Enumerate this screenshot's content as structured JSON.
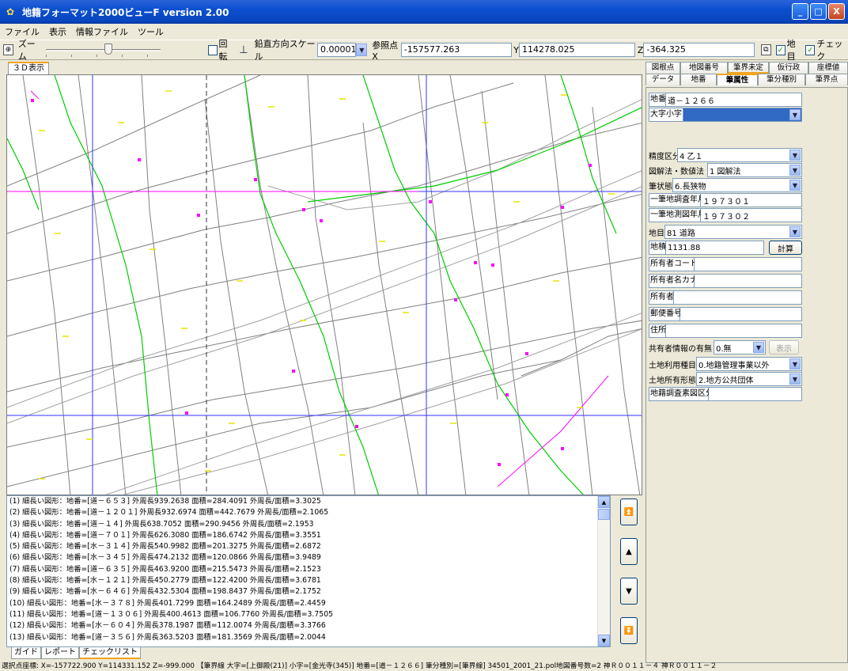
{
  "window": {
    "title": "地籍フォーマット2000ビューF version 2.00",
    "minimize": "_",
    "maximize": "□",
    "close": "X"
  },
  "menu": [
    "ファイル",
    "表示",
    "情報ファイル",
    "ツール"
  ],
  "toolbar": {
    "zoom_label": "ズーム",
    "zoom_level": 0.55,
    "rotate_label": "回転",
    "vscale_label": "鉛直方向スケール",
    "vscale_value": "0.00001",
    "refpt_label": "参照点X",
    "x_value": "-157577.263",
    "y_label": "Y",
    "y_value": "114278.025",
    "z_label": "Z",
    "z_value": "-364.325",
    "chimoku_label": "地目",
    "check_label": "チェック"
  },
  "map": {
    "tab_label": "３Ｄ表示"
  },
  "right": {
    "tabs_row1": [
      "図根点",
      "地図番号",
      "筆界未定",
      "仮行政",
      "座標値"
    ],
    "tabs_row2": [
      "データ",
      "地番",
      "筆属性",
      "筆分種別",
      "筆界点"
    ],
    "fields": {
      "chiban_label": "地番",
      "chiban_value": "道－１２６６",
      "oaza_label": "大字小字",
      "seido_label": "精度区分",
      "seido_value": "4 乙１",
      "zukai_label": "図解法・数値法",
      "zukai_value": "1 図解法",
      "hitsujo_label": "筆状態",
      "hitsujo_value": "6.長狭物",
      "chosa_label": "一筆地調査年月",
      "chosa_value": "１９７３０１",
      "sokuryo_label": "一筆地測図年月",
      "sokuryo_value": "１９７３０２",
      "chimoku_label": "地目",
      "chimoku_value": "81 道路",
      "chiseki_label": "地積",
      "chiseki_value": "1131.88",
      "calc_button": "計算",
      "owner_code_label": "所有者コード",
      "owner_kana_label": "所有者名カナ",
      "owner_label": "所有者",
      "postal_label": "郵便番号",
      "address_label": "住所",
      "kyoyu_label": "共有者情報の有無",
      "kyoyu_value": "0.無",
      "display_button": "表示",
      "riyo_label": "土地利用種目",
      "riyo_value": "0.地籍管理事業以外",
      "shoyu_label": "土地所有形態",
      "shoyu_value": "2.地方公共団体",
      "sozu_label": "地籍調査素図区分"
    }
  },
  "output_lines": [
    "(1) 細長い図形：地番=[道－６５３] 外周長939.2638 面積=284.4091 外周長/面積=3.3025",
    "(2) 細長い図形：地番=[道－１２０１] 外周長932.6974 面積=442.7679 外周長/面積=2.1065",
    "(3) 細長い図形：地番=[道－１４] 外周長638.7052 面積=290.9456 外周長/面積=2.1953",
    "(4) 細長い図形：地番=[道－７０１] 外周長626.3080 面積=186.6742 外周長/面積=3.3551",
    "(5) 細長い図形：地番=[水－３１４] 外周長540.9982 面積=201.3275 外周長/面積=2.6872",
    "(6) 細長い図形：地番=[水－３４５] 外周長474.2132 面積=120.0866 外周長/面積=3.9489",
    "(7) 細長い図形：地番=[道－６３５] 外周長463.9200 面積=215.5473 外周長/面積=2.1523",
    "(8) 細長い図形：地番=[水－１２１] 外周長450.2779 面積=122.4200 外周長/面積=3.6781",
    "(9) 細長い図形：地番=[水－６４６] 外周長432.5304 面積=198.8437 外周長/面積=2.1752",
    "(10) 細長い図形：地番=[水－３７８] 外周長401.7299 面積=164.2489 外周長/面積=2.4459",
    "(11) 細長い図形：地番=[道－１３０６] 外周長400.4613 面積=106.7760 外周長/面積=3.7505",
    "(12) 細長い図形：地番=[水－６０４] 外周長378.1987 面積=112.0074 外周長/面積=3.3766",
    "(13) 細長い図形：地番=[道－３５６] 外周長363.5203 面積=181.3569 外周長/面積=2.0044"
  ],
  "nav": {
    "first": "⏫",
    "up": "▲",
    "down": "▼",
    "last": "⏬"
  },
  "bottom_tabs": [
    "ガイド",
    "レポート",
    "チェックリスト"
  ],
  "status": "選択点座標: X=-157722.900 Y=114331.152 Z=-999.000 【筆界線 大字=[上御殿(21)] 小字=[金光寺(345)] 地番=[道－１２６６] 筆分種別=[筆界線] 34501_2001_21.pol地図番号数=2 神Ｒ００１１－４ 神Ｒ００１１－２",
  "colors": {
    "title_bar": "#0b4fcf",
    "parcel_line": "#808080",
    "road_line": "#00cc00",
    "grid_line": "#3333ff",
    "magenta": "#ff00ff",
    "label_mark": "#e6e600"
  }
}
